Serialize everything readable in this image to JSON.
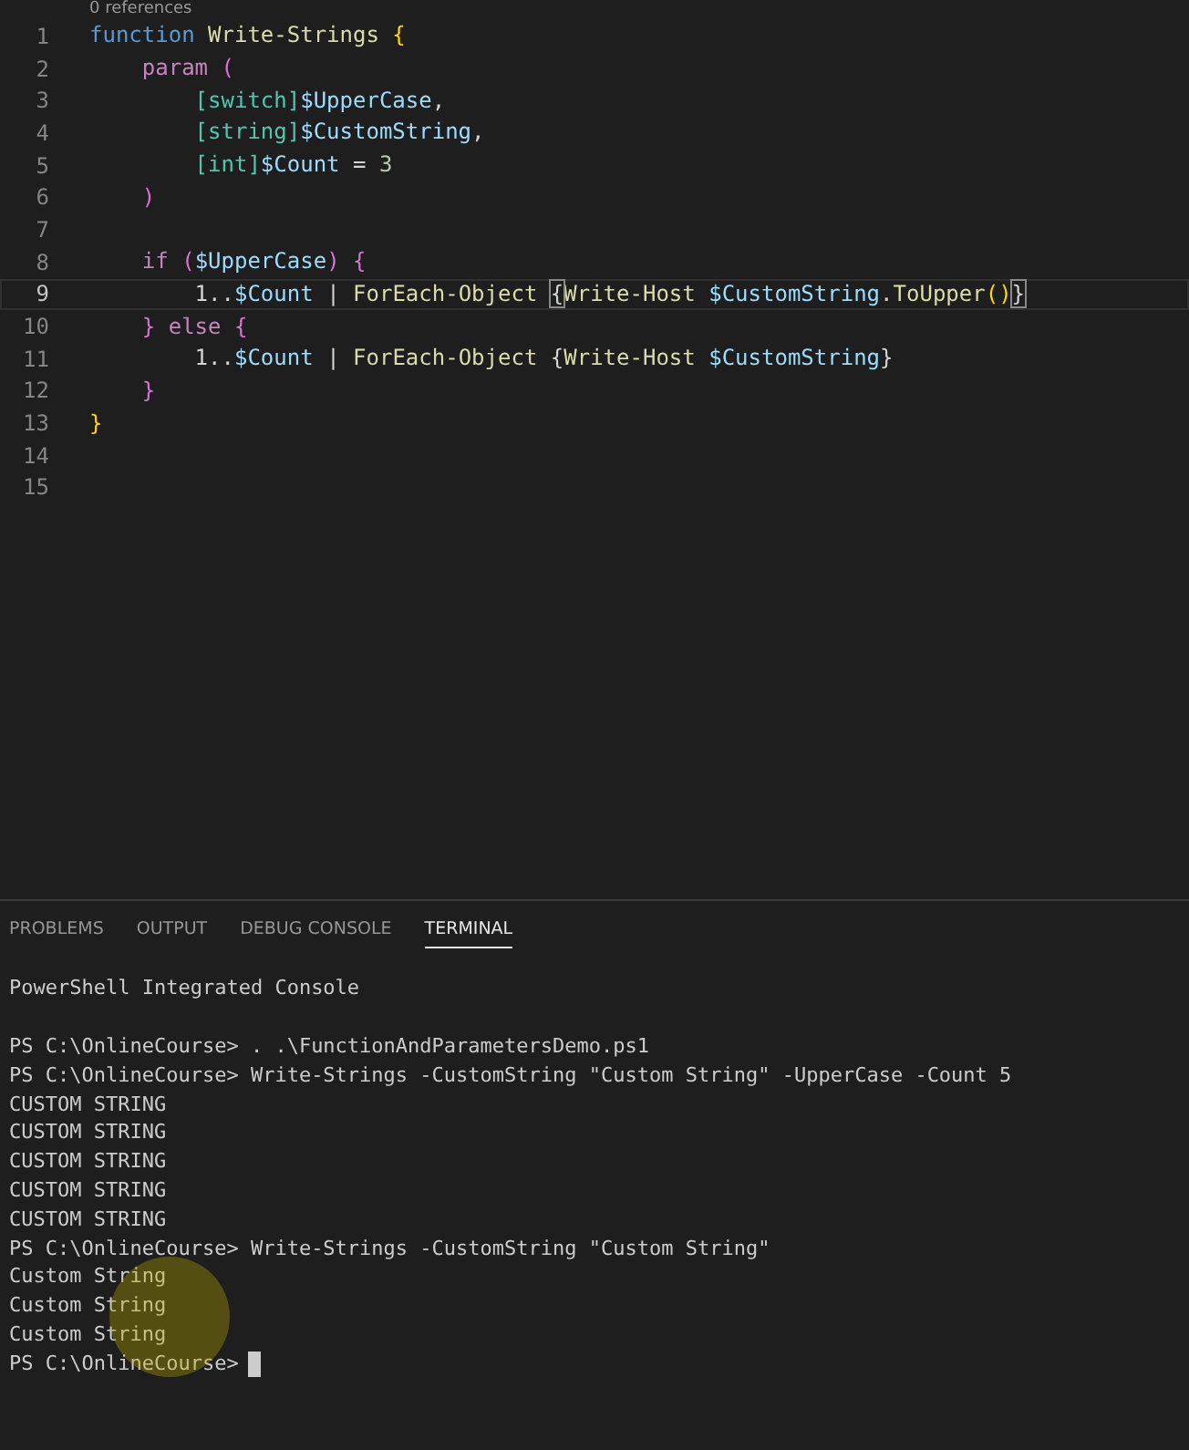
{
  "editor": {
    "codelens": "0 references",
    "lines": [
      {
        "number": "1",
        "selected": false,
        "tokens": [
          {
            "kind": "keyword",
            "text": "function"
          },
          {
            "kind": "function",
            "text": " Write-Strings"
          },
          {
            "kind": "brace",
            "text": " {"
          }
        ]
      },
      {
        "number": "2",
        "selected": false,
        "tokens": [
          {
            "kind": "control",
            "text": "    param"
          },
          {
            "kind": "paren",
            "text": " ("
          }
        ]
      },
      {
        "number": "3",
        "selected": false,
        "tokens": [
          {
            "kind": "type",
            "text": "        [switch]"
          },
          {
            "kind": "variable",
            "text": "$UpperCase"
          },
          {
            "kind": "plain",
            "text": ","
          }
        ]
      },
      {
        "number": "4",
        "selected": false,
        "tokens": [
          {
            "kind": "type",
            "text": "        [string]"
          },
          {
            "kind": "variable",
            "text": "$CustomString"
          },
          {
            "kind": "plain",
            "text": ","
          }
        ]
      },
      {
        "number": "5",
        "selected": false,
        "tokens": [
          {
            "kind": "type",
            "text": "        [int]"
          },
          {
            "kind": "variable",
            "text": "$Count"
          },
          {
            "kind": "plain",
            "text": " ="
          },
          {
            "kind": "number",
            "text": " 3"
          }
        ]
      },
      {
        "number": "6",
        "selected": false,
        "tokens": [
          {
            "kind": "paren",
            "text": "    )"
          }
        ]
      },
      {
        "number": "7",
        "selected": false
      },
      {
        "number": "8",
        "selected": false,
        "tokens": [
          {
            "kind": "control",
            "text": "    if"
          },
          {
            "kind": "paren",
            "text": " ("
          },
          {
            "kind": "variable",
            "text": "$UpperCase"
          },
          {
            "kind": "paren",
            "text": ")"
          },
          {
            "kind": "paren",
            "text": " {"
          }
        ]
      },
      {
        "number": "9",
        "selected": true,
        "tokens": [
          {
            "kind": "plain",
            "text": "        1.."
          },
          {
            "kind": "variable",
            "text": "$Count"
          },
          {
            "kind": "plain",
            "text": " |"
          },
          {
            "kind": "function",
            "text": " ForEach-Object "
          },
          {
            "kind": "match",
            "text": "{"
          },
          {
            "kind": "function",
            "text": "Write-Host"
          },
          {
            "kind": "variable",
            "text": " $CustomString"
          },
          {
            "kind": "plain",
            "text": "."
          },
          {
            "kind": "function",
            "text": "ToUpper"
          },
          {
            "kind": "brace",
            "text": "()"
          },
          {
            "kind": "match",
            "text": "}"
          }
        ]
      },
      {
        "number": "10",
        "selected": false,
        "tokens": [
          {
            "kind": "paren",
            "text": "    }"
          },
          {
            "kind": "control",
            "text": " else"
          },
          {
            "kind": "paren",
            "text": " {"
          }
        ]
      },
      {
        "number": "11",
        "selected": false,
        "tokens": [
          {
            "kind": "plain",
            "text": "        1.."
          },
          {
            "kind": "variable",
            "text": "$Count"
          },
          {
            "kind": "plain",
            "text": " |"
          },
          {
            "kind": "function",
            "text": " ForEach-Object"
          },
          {
            "kind": "plain",
            "text": " {"
          },
          {
            "kind": "function",
            "text": "Write-Host"
          },
          {
            "kind": "variable",
            "text": " $CustomString"
          },
          {
            "kind": "plain",
            "text": "}"
          }
        ]
      },
      {
        "number": "12",
        "selected": false,
        "tokens": [
          {
            "kind": "paren",
            "text": "    }"
          }
        ]
      },
      {
        "number": "13",
        "selected": false,
        "tokens": [
          {
            "kind": "brace",
            "text": "}"
          }
        ]
      },
      {
        "number": "14",
        "selected": false
      },
      {
        "number": "15",
        "selected": false
      }
    ]
  },
  "panel": {
    "tabs": [
      {
        "label": "PROBLEMS",
        "selected": false
      },
      {
        "label": "OUTPUT",
        "selected": false
      },
      {
        "label": "DEBUG CONSOLE",
        "selected": false
      },
      {
        "label": "TERMINAL",
        "selected": true
      }
    ],
    "terminal": {
      "title": "PowerShell Integrated Console",
      "lines": [
        "PS C:\\OnlineCourse> . .\\FunctionAndParametersDemo.ps1",
        "PS C:\\OnlineCourse> Write-Strings -CustomString \"Custom String\" -UpperCase -Count 5",
        "CUSTOM STRING",
        "CUSTOM STRING",
        "CUSTOM STRING",
        "CUSTOM STRING",
        "CUSTOM STRING",
        "PS C:\\OnlineCourse> Write-Strings -CustomString \"Custom String\"",
        "Custom String",
        "Custom String",
        "Custom String"
      ],
      "prompt": "PS C:\\OnlineCourse>"
    }
  }
}
